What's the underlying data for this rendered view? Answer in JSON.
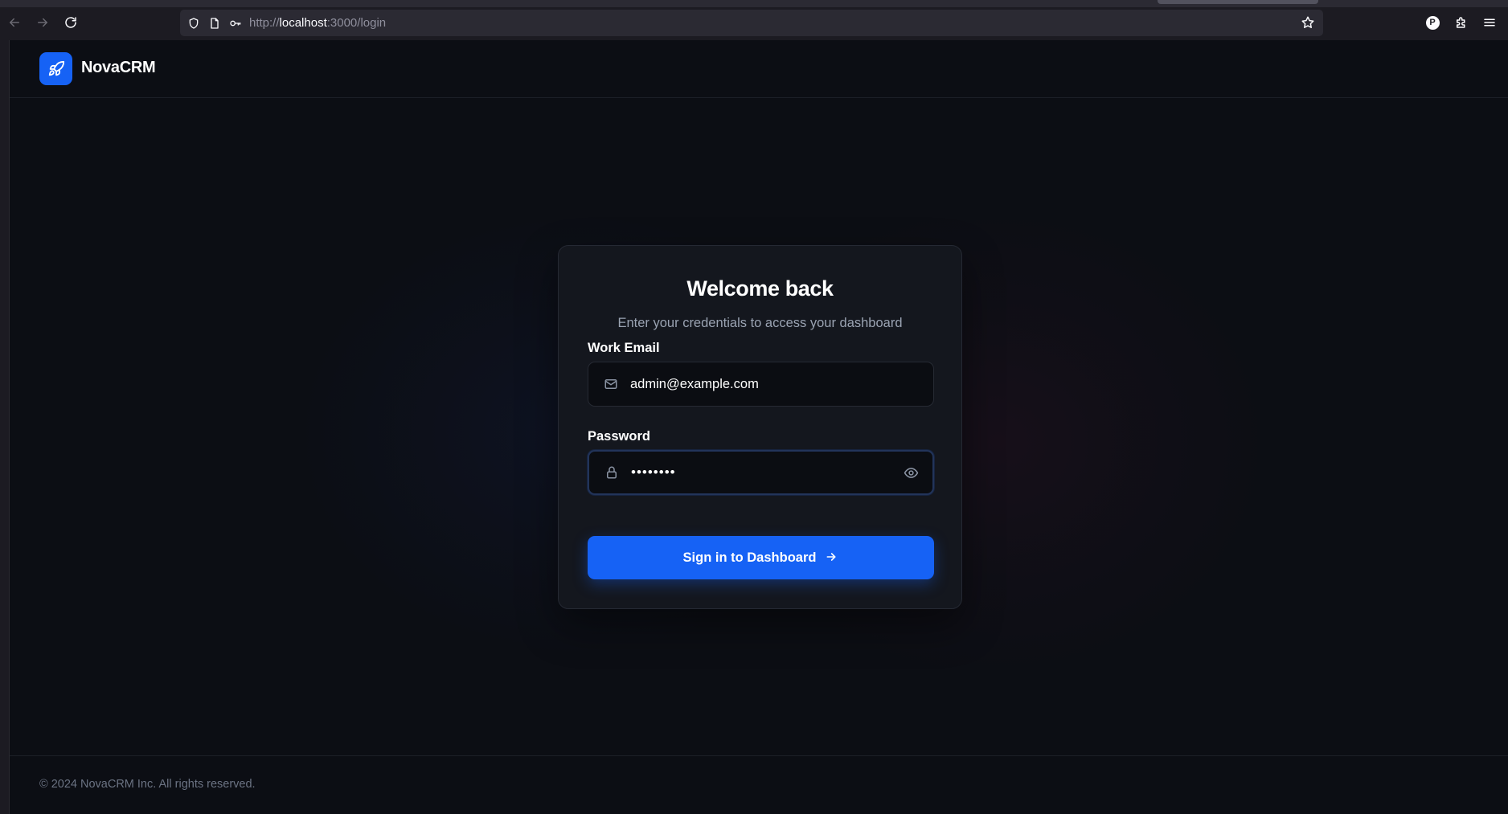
{
  "browser": {
    "url_scheme": "http://",
    "url_host": "localhost",
    "url_path": ":3000/login",
    "profile_initial": "P",
    "icons": {
      "back": "arrow-left-icon",
      "forward": "arrow-right-icon",
      "reload": "reload-icon",
      "shield": "shield-icon",
      "page": "page-icon",
      "key": "key-icon",
      "bookmark": "star-icon",
      "extensions": "puzzle-icon",
      "menu": "hamburger-icon"
    }
  },
  "app": {
    "brand_name": "NovaCRM",
    "logo_icon": "rocket-icon",
    "accent_color": "#1662f5"
  },
  "login": {
    "title": "Welcome back",
    "subtitle": "Enter your credentials to access your dashboard",
    "email": {
      "label": "Work Email",
      "value": "admin@example.com",
      "icon": "mail-icon"
    },
    "password": {
      "label": "Password",
      "value": "••••••••",
      "icon": "lock-icon",
      "toggle_icon": "eye-icon"
    },
    "submit": {
      "label": "Sign in to Dashboard",
      "icon": "arrow-right-icon"
    }
  },
  "footer": {
    "copyright": "© 2024 NovaCRM Inc. All rights reserved."
  }
}
